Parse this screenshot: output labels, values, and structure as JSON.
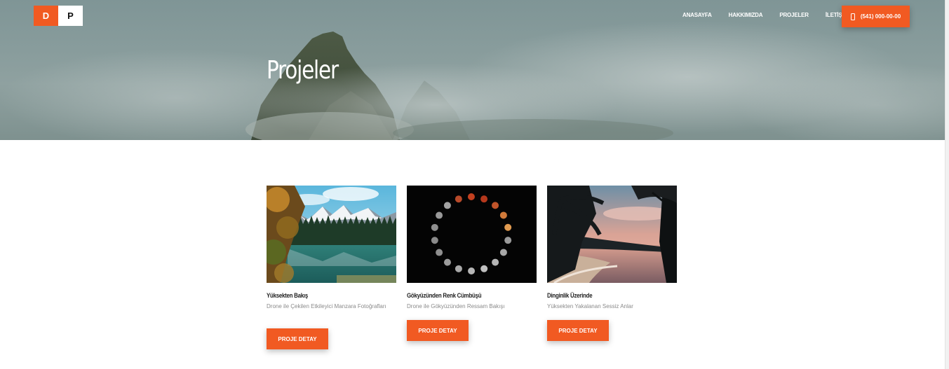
{
  "logo": {
    "left": "D",
    "right": "P"
  },
  "nav": {
    "items": [
      "ANASAYFA",
      "HAKKIMIZDA",
      "PROJELER",
      "İLETİŞİM"
    ],
    "phone": "(541) 000-00-00"
  },
  "hero": {
    "title": "Projeler"
  },
  "colors": {
    "accent": "#f15a22"
  },
  "projects": [
    {
      "title": "Yüksekten Bakış",
      "description": "Drone ile Çekilen Etkileyici Manzara Fotoğrafları",
      "button": "PROJE DETAY"
    },
    {
      "title": "Gökyüzünden Renk Cümbüşü",
      "description": "Drone ile Gökyüzünden Ressam Bakışı",
      "button": "PROJE DETAY"
    },
    {
      "title": "Dinginlik Üzerinde",
      "description": "Yüksekten Yakalanan Sessiz Anlar",
      "button": "PROJE DETAY"
    }
  ]
}
